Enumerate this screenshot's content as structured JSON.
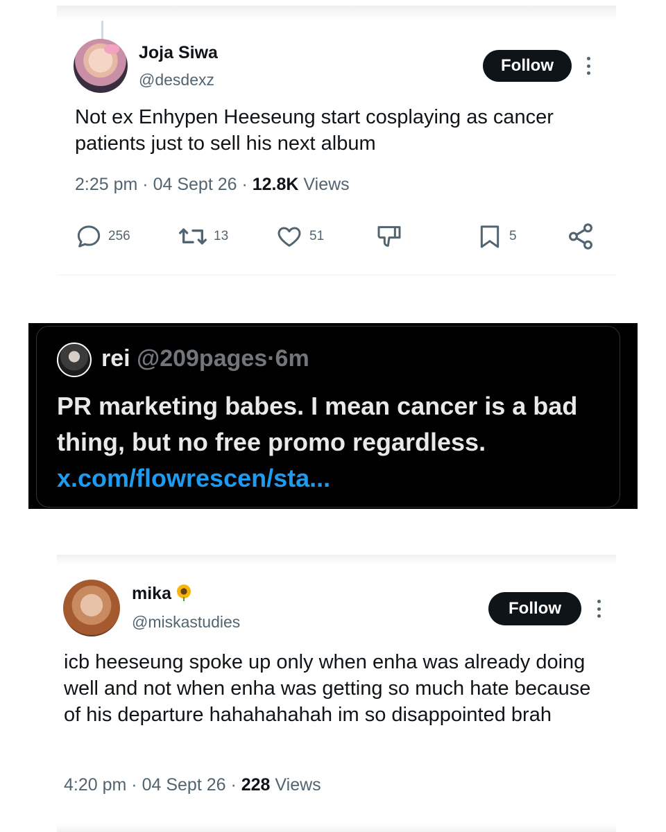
{
  "tweet1": {
    "name": "Joja Siwa",
    "handle": "@desdexz",
    "follow_label": "Follow",
    "text": "Not ex Enhypen Heeseung start cosplaying as cancer patients just to sell his next album",
    "time": "2:25 pm",
    "sep1": "·",
    "date": "04 Sept 26",
    "sep2": "·",
    "views_count": "12.8K",
    "views_label": "Views",
    "actions": {
      "replies": "256",
      "reposts": "13",
      "likes": "51",
      "bookmarks": "5"
    }
  },
  "quote": {
    "name": "rei",
    "handle": "@209pages",
    "sep": "·",
    "age": "6m",
    "text_line": "PR marketing babes. I mean cancer is a bad thing, but no free promo regardless.",
    "link": "x.com/flowrescen/sta..."
  },
  "tweet2": {
    "name": "mika",
    "name_emoji": "sunflower-icon",
    "handle": "@miskastudies",
    "follow_label": "Follow",
    "text": "icb heeseung spoke up only when enha was already doing well and not when enha was getting so much hate because of his departure hahahahahah im so disappointed brah",
    "time": "4:20 pm",
    "sep1": "·",
    "date": "04 Sept 26",
    "sep2": "·",
    "views_count": "228",
    "views_label": "Views"
  },
  "colors": {
    "text_primary": "#0f1419",
    "text_secondary": "#536471",
    "follow_bg": "#0f1419",
    "dark_bg": "#000000",
    "dark_text": "#e7e9ea",
    "dark_muted": "#71767b",
    "link": "#1d9bf0"
  }
}
